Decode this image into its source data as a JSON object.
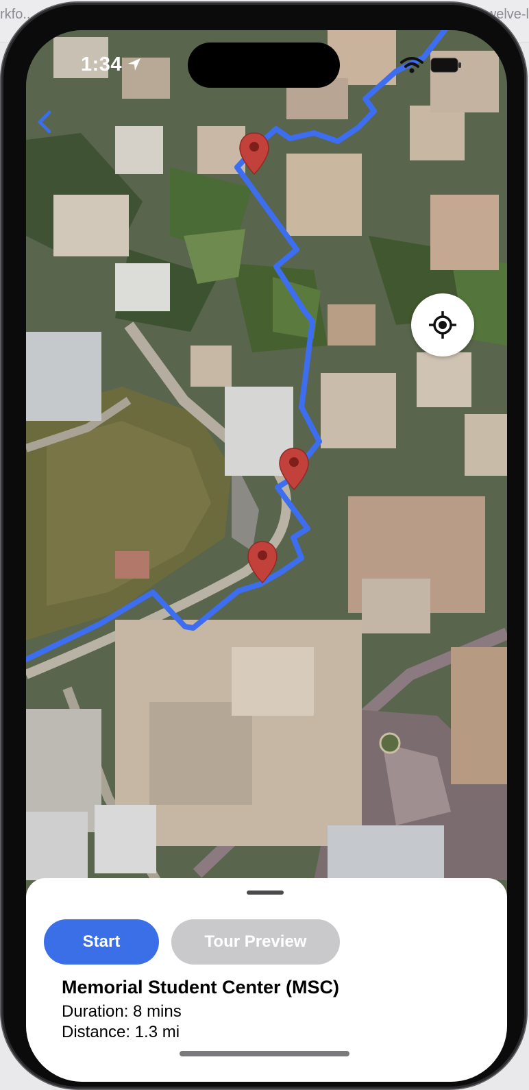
{
  "browser": {
    "tab_left": "rkfo...",
    "tab_right": "welve-l"
  },
  "status_bar": {
    "time": "1:34"
  },
  "icons": {
    "back": "chevron-left-icon",
    "location": "navigation-arrow-icon",
    "wifi": "wifi-icon",
    "battery": "battery-icon",
    "locate": "crosshair-icon",
    "pin": "map-pin-icon"
  },
  "colors": {
    "route": "#3d6ef0",
    "pin": "#c2413b",
    "primary_button": "#3a6fe7",
    "disabled_button": "#c9c9cb"
  },
  "sheet": {
    "start_label": "Start",
    "preview_label": "Tour Preview",
    "place_name": "Memorial Student Center (MSC)",
    "duration": "Duration: 8 mins",
    "distance": "Distance: 1.3 mi"
  }
}
